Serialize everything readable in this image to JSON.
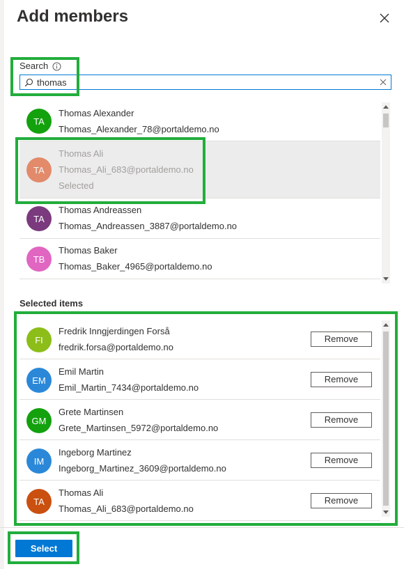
{
  "header": {
    "title": "Add members"
  },
  "search": {
    "label": "Search",
    "value": "thomas"
  },
  "results": [
    {
      "initials": "TA",
      "name": "Thomas Alexander",
      "email": "Thomas_Alexander_78@portaldemo.no",
      "color": "#13a10e",
      "selected": false,
      "status": ""
    },
    {
      "initials": "TA",
      "name": "Thomas Ali",
      "email": "Thomas_Ali_683@portaldemo.no",
      "color": "#da3b01",
      "selected": true,
      "status": "Selected"
    },
    {
      "initials": "TA",
      "name": "Thomas Andreassen",
      "email": "Thomas_Andreassen_3887@portaldemo.no",
      "color": "#7a3a7d",
      "selected": false,
      "status": ""
    },
    {
      "initials": "TB",
      "name": "Thomas Baker",
      "email": "Thomas_Baker_4965@portaldemo.no",
      "color": "#e066c1",
      "selected": false,
      "status": ""
    }
  ],
  "selected_section": {
    "title": "Selected items",
    "remove_label": "Remove",
    "items": [
      {
        "initials": "FI",
        "name": "Fredrik Inngjerdingen Forså",
        "email": "fredrik.forsa@portaldemo.no",
        "color": "#8cbd18"
      },
      {
        "initials": "EM",
        "name": "Emil Martin",
        "email": "Emil_Martin_7434@portaldemo.no",
        "color": "#2b88d8"
      },
      {
        "initials": "GM",
        "name": "Grete Martinsen",
        "email": "Grete_Martinsen_5972@portaldemo.no",
        "color": "#13a10e"
      },
      {
        "initials": "IM",
        "name": "Ingeborg Martinez",
        "email": "Ingeborg_Martinez_3609@portaldemo.no",
        "color": "#2b88d8"
      },
      {
        "initials": "TA",
        "name": "Thomas Ali",
        "email": "Thomas_Ali_683@portaldemo.no",
        "color": "#ca5010"
      }
    ]
  },
  "footer": {
    "select_label": "Select"
  },
  "colors": {
    "accent": "#0078d4",
    "highlight": "#22ad3c"
  }
}
